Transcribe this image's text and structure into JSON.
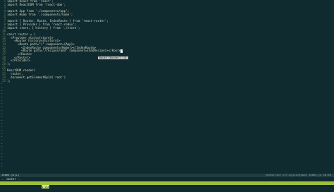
{
  "editor": {
    "lines": [
      {
        "num": "1",
        "text": "import React from 'react';"
      },
      {
        "num": "2",
        "text": "import ReactDOM from 'react-dom';"
      },
      {
        "num": "3",
        "text": ""
      },
      {
        "num": "4",
        "text": "import App from './components/app';"
      },
      {
        "num": "5",
        "text": "import Home from './components/home';"
      },
      {
        "num": "6",
        "text": ""
      },
      {
        "num": "7",
        "text": "import { Router, Route, IndexRoute } from 'react-router';"
      },
      {
        "num": "8",
        "text": "import { Provider } from 'react-redux';"
      },
      {
        "num": "9",
        "text": "import store, { history } from './store';"
      },
      {
        "num": "10",
        "text": ""
      },
      {
        "num": "11",
        "text": "const router = ("
      },
      {
        "num": "12",
        "text": "  <Provider store={store}>"
      },
      {
        "num": "13",
        "text": "    <Router history={history}>"
      },
      {
        "num": "14",
        "text": "      <Route path=\"/\" component={App}>"
      },
      {
        "num": "15",
        "text": "        <IndexRoute component={Home}></IndexRoute>"
      },
      {
        "num": "16",
        "text": "        <Route path=\"/recipes/add\" component={AddRecipe}></Route"
      },
      {
        "num": "17",
        "text": "      </Route>"
      },
      {
        "num": "18",
        "text": "    </Router>"
      },
      {
        "num": "19",
        "text": "  </Provider>"
      },
      {
        "num": "20",
        "text": ");"
      },
      {
        "num": "21",
        "text": ""
      },
      {
        "num": "22",
        "text": "ReactDOM.render("
      },
      {
        "num": "23",
        "text": "  router,"
      },
      {
        "num": "24",
        "text": "  document.getElementById('root')"
      },
      {
        "num": "25",
        "text": ");"
      }
    ],
    "empty_marker": "~",
    "tooltip": "Route [Router] (J)"
  },
  "statusline": {
    "left": "index.js[+]",
    "middle": "javascript utf-8[unix]",
    "right": "route index.js  16:55"
  },
  "mode_line": "-- INSERT --",
  "tmux": {
    "windows": [
      "1 zsh",
      "2 node",
      "3 node",
      "4 vim"
    ],
    "active_index": 3,
    "clock": "2016-05-21  12:59"
  }
}
